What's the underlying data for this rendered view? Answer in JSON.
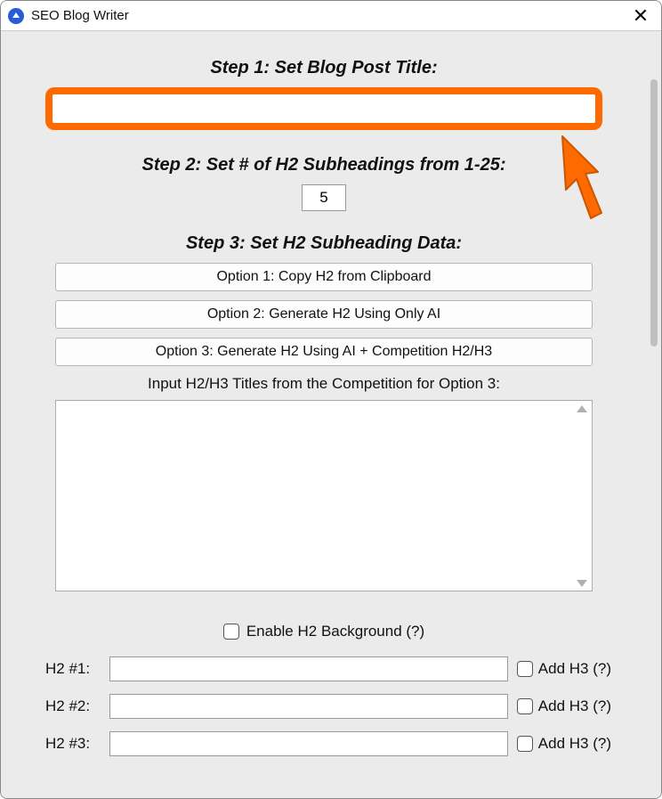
{
  "window": {
    "title": "SEO Blog Writer"
  },
  "steps": {
    "s1_heading": "Step 1: Set Blog Post Title:",
    "s1_title_value": "",
    "s2_heading": "Step 2: Set # of H2 Subheadings from 1-25:",
    "s2_count_value": "5",
    "s3_heading": "Step 3: Set H2 Subheading Data:",
    "s3_option1": "Option 1: Copy H2 from Clipboard",
    "s3_option2": "Option 2: Generate H2 Using Only AI",
    "s3_option3": "Option 3: Generate H2 Using AI + Competition H2/H3",
    "s3_competition_label": "Input H2/H3 Titles from the Competition for Option 3:",
    "s3_competition_value": ""
  },
  "enable_bg_label": "Enable H2 Background (?)",
  "enable_bg_checked": false,
  "h2_rows": [
    {
      "label": "H2 #1:",
      "value": "",
      "add_h3_label": "Add H3 (?)",
      "add_h3_checked": false
    },
    {
      "label": "H2 #2:",
      "value": "",
      "add_h3_label": "Add H3 (?)",
      "add_h3_checked": false
    },
    {
      "label": "H2 #3:",
      "value": "",
      "add_h3_label": "Add H3 (?)",
      "add_h3_checked": false
    }
  ]
}
